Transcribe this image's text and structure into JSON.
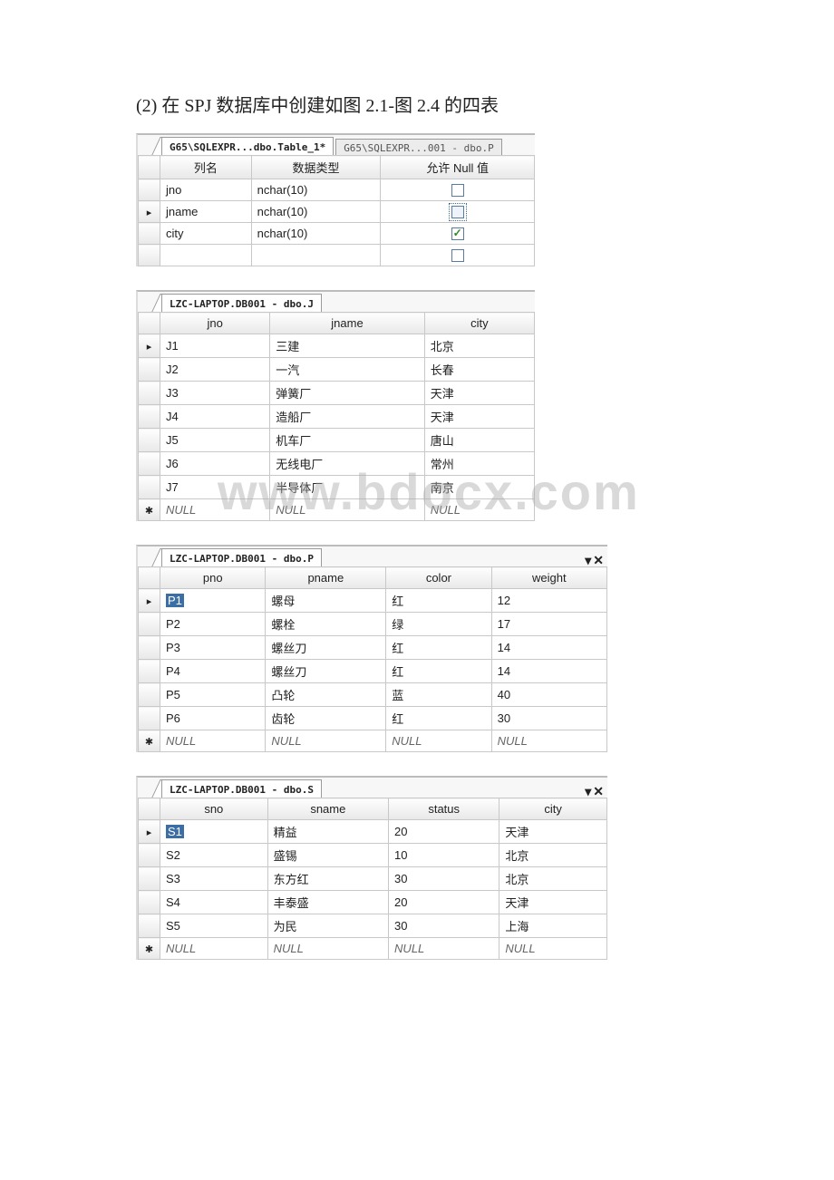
{
  "caption": "(2) 在 SPJ 数据库中创建如图 2.1-图 2.4 的四表",
  "designer": {
    "tabs": {
      "active": "G65\\SQLEXPR...dbo.Table_1*",
      "inactive": "G65\\SQLEXPR...001 - dbo.P"
    },
    "headers": {
      "col": "列名",
      "dtype": "数据类型",
      "allownull": "允许 Null 值"
    },
    "rows": [
      {
        "col": "jno",
        "dtype": "nchar(10)",
        "allow": false,
        "pointer": false,
        "focus": false
      },
      {
        "col": "jname",
        "dtype": "nchar(10)",
        "allow": false,
        "pointer": true,
        "focus": true
      },
      {
        "col": "city",
        "dtype": "nchar(10)",
        "allow": true,
        "pointer": false,
        "focus": false
      }
    ]
  },
  "tableJ": {
    "tab": "LZC-LAPTOP.DB001 - dbo.J",
    "headers": [
      "jno",
      "jname",
      "city"
    ],
    "rows": [
      [
        "J1",
        "三建",
        "北京"
      ],
      [
        "J2",
        "一汽",
        "长春"
      ],
      [
        "J3",
        "弹簧厂",
        "天津"
      ],
      [
        "J4",
        "造船厂",
        "天津"
      ],
      [
        "J5",
        "机车厂",
        "唐山"
      ],
      [
        "J6",
        "无线电厂",
        "常州"
      ],
      [
        "J7",
        "半导体厂",
        "南京"
      ]
    ],
    "nullLabel": "NULL"
  },
  "tableP": {
    "tab": "LZC-LAPTOP.DB001 - dbo.P",
    "headers": [
      "pno",
      "pname",
      "color",
      "weight"
    ],
    "rows": [
      [
        "P1",
        "螺母",
        "红",
        "12"
      ],
      [
        "P2",
        "螺栓",
        "绿",
        "17"
      ],
      [
        "P3",
        "螺丝刀",
        "红",
        "14"
      ],
      [
        "P4",
        "螺丝刀",
        "红",
        "14"
      ],
      [
        "P5",
        "凸轮",
        "蓝",
        "40"
      ],
      [
        "P6",
        "齿轮",
        "红",
        "30"
      ]
    ],
    "nullLabel": "NULL"
  },
  "tableS": {
    "tab": "LZC-LAPTOP.DB001 - dbo.S",
    "headers": [
      "sno",
      "sname",
      "status",
      "city"
    ],
    "rows": [
      [
        "S1",
        "精益",
        "20",
        "天津"
      ],
      [
        "S2",
        "盛锡",
        "10",
        "北京"
      ],
      [
        "S3",
        "东方红",
        "30",
        "北京"
      ],
      [
        "S4",
        "丰泰盛",
        "20",
        "天津"
      ],
      [
        "S5",
        "为民",
        "30",
        "上海"
      ]
    ],
    "nullLabel": "NULL"
  },
  "watermark": "www.bdocx.com"
}
